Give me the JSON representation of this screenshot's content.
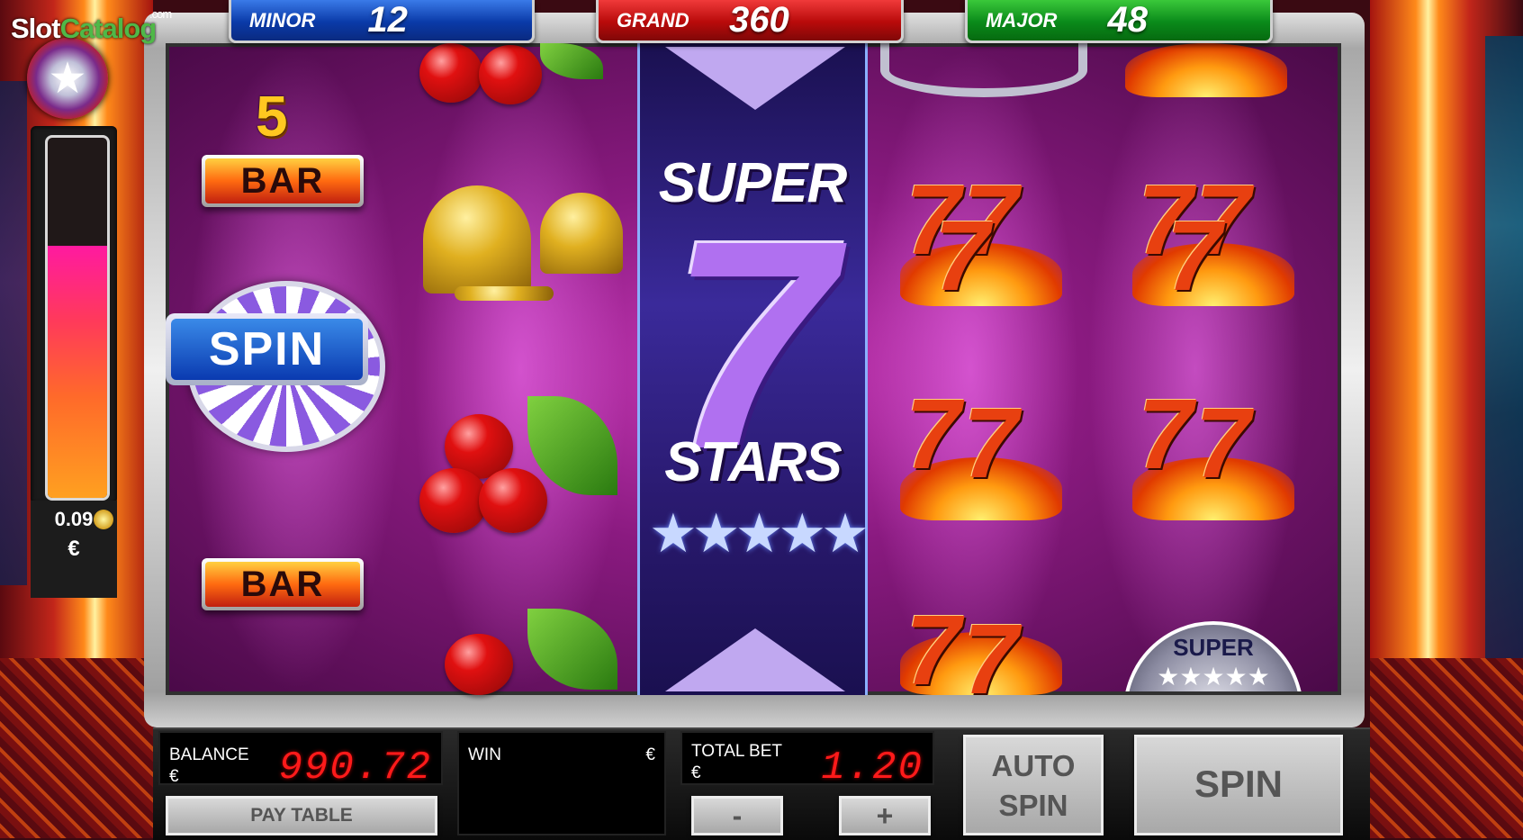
{
  "logo": {
    "part1": "Slot",
    "part2": "Catalog",
    "suffix": ".com"
  },
  "jackpots": {
    "minor": {
      "label": "MINOR",
      "value": "12"
    },
    "grand": {
      "label": "GRAND",
      "value": "360"
    },
    "major": {
      "label": "MAJOR",
      "value": "48"
    }
  },
  "meter": {
    "value": "0.09",
    "currency": "€",
    "fill_fraction": 0.7
  },
  "reels": {
    "reel1": {
      "five": "5",
      "bar_top": "BAR",
      "spin": "SPIN",
      "bar_bottom": "BAR"
    },
    "reel3": {
      "super": "SUPER",
      "seven": "7",
      "stars": "STARS",
      "star_glyphs": "★★★★★"
    },
    "reel5": {
      "seven": "7",
      "super_coin": "SUPER",
      "super_coin_stars": "★★★★★"
    }
  },
  "panel": {
    "balance_label": "BALANCE",
    "balance_currency": "€",
    "balance_value": "990.72",
    "win_label": "WIN",
    "win_currency": "€",
    "total_bet_label": "TOTAL BET",
    "total_bet_currency": "€",
    "total_bet_value": "1.20",
    "pay_table_label": "PAY TABLE",
    "minus_label": "-",
    "plus_label": "+",
    "auto_spin_line1": "AUTO",
    "auto_spin_line2": "SPIN",
    "spin_label": "SPIN"
  }
}
